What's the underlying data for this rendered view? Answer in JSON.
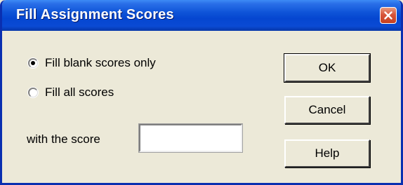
{
  "window": {
    "title": "Fill Assignment Scores",
    "close_icon": "close-icon"
  },
  "options": {
    "fill_blank_label": "Fill blank scores only",
    "fill_blank_checked": true,
    "fill_all_label": "Fill all scores",
    "fill_all_checked": false
  },
  "score": {
    "label": "with the score",
    "value": ""
  },
  "buttons": {
    "ok": "OK",
    "cancel": "Cancel",
    "help": "Help"
  },
  "colors": {
    "titlebar": "#0a4ad4",
    "window_bg": "#ece9d8",
    "close_button": "#d8553a"
  }
}
